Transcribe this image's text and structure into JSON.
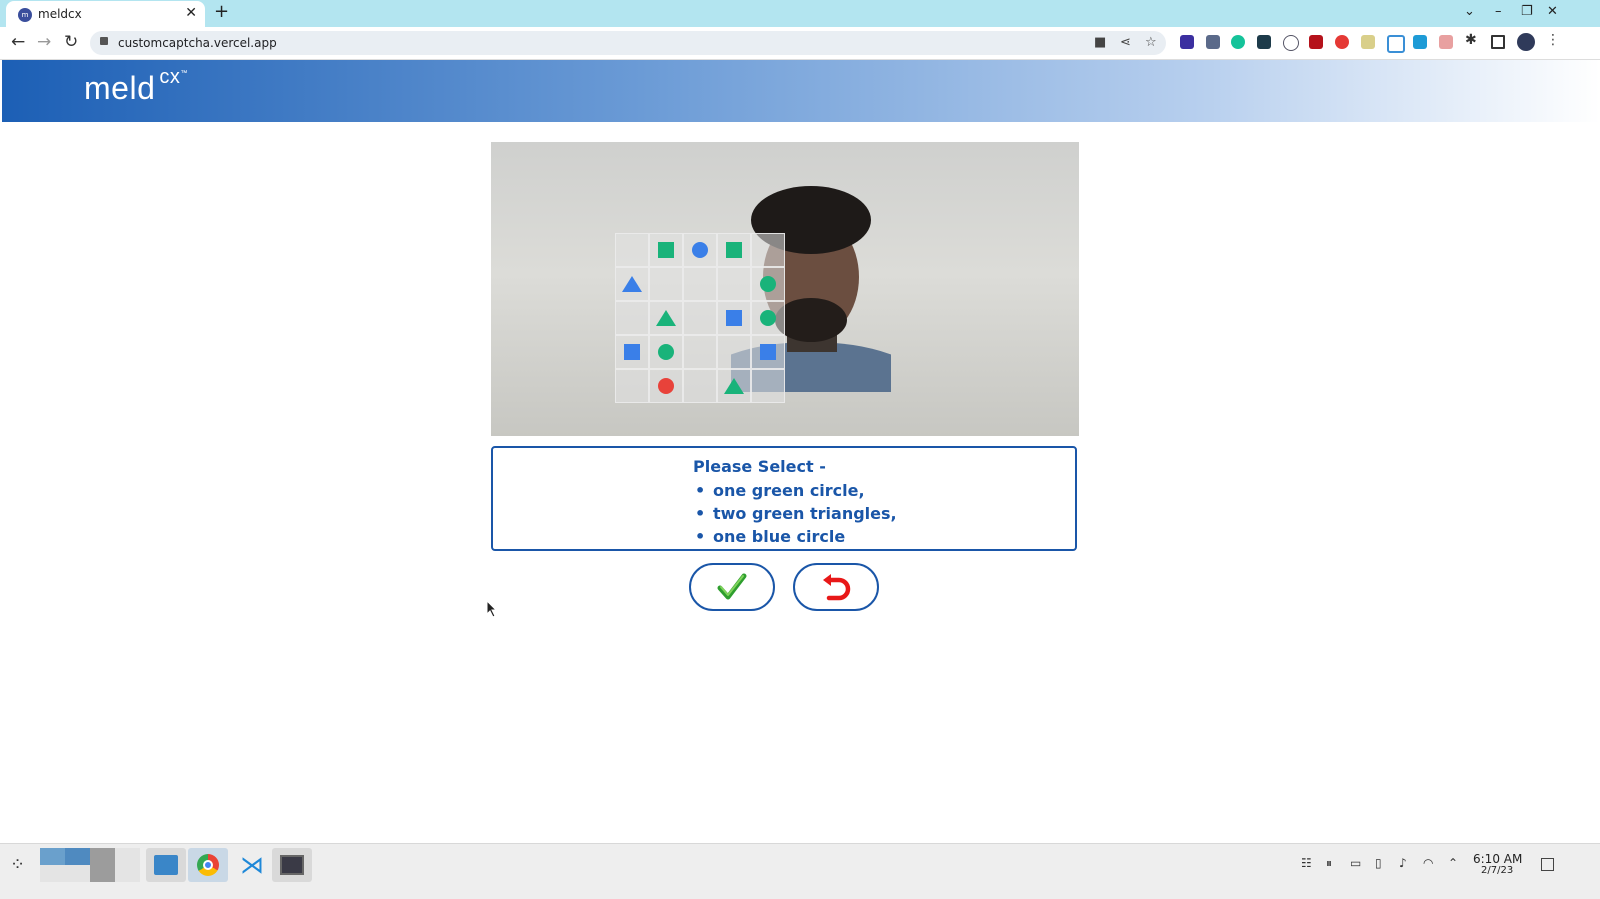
{
  "browser": {
    "tab_title": "meldcx",
    "tab_close": "✕",
    "new_tab": "+",
    "url": "customcaptcha.vercel.app"
  },
  "site": {
    "logo_main": "meld",
    "logo_sub": "cx",
    "logo_tm": "™"
  },
  "captcha": {
    "grid": [
      [
        null,
        {
          "shape": "square",
          "color": "green"
        },
        {
          "shape": "circle",
          "color": "blue"
        },
        {
          "shape": "square",
          "color": "green"
        },
        null
      ],
      [
        {
          "shape": "triangle",
          "color": "blue"
        },
        null,
        null,
        null,
        {
          "shape": "circle",
          "color": "green"
        }
      ],
      [
        null,
        {
          "shape": "triangle",
          "color": "green"
        },
        null,
        {
          "shape": "square",
          "color": "blue"
        },
        {
          "shape": "circle",
          "color": "green"
        }
      ],
      [
        {
          "shape": "square",
          "color": "blue"
        },
        {
          "shape": "circle",
          "color": "green"
        },
        null,
        null,
        {
          "shape": "square",
          "color": "blue"
        }
      ],
      [
        null,
        {
          "shape": "circle",
          "color": "red"
        },
        null,
        {
          "shape": "triangle",
          "color": "green"
        },
        null
      ]
    ],
    "colors": {
      "green": "#19b37a",
      "blue": "#3a7fe8",
      "red": "#e8423a"
    }
  },
  "instructions": {
    "heading": "Please Select -",
    "items": [
      "one green circle,",
      "two green triangles,",
      "one blue circle"
    ]
  },
  "taskbar": {
    "time": "6:10 AM",
    "date": "2/7/23"
  }
}
